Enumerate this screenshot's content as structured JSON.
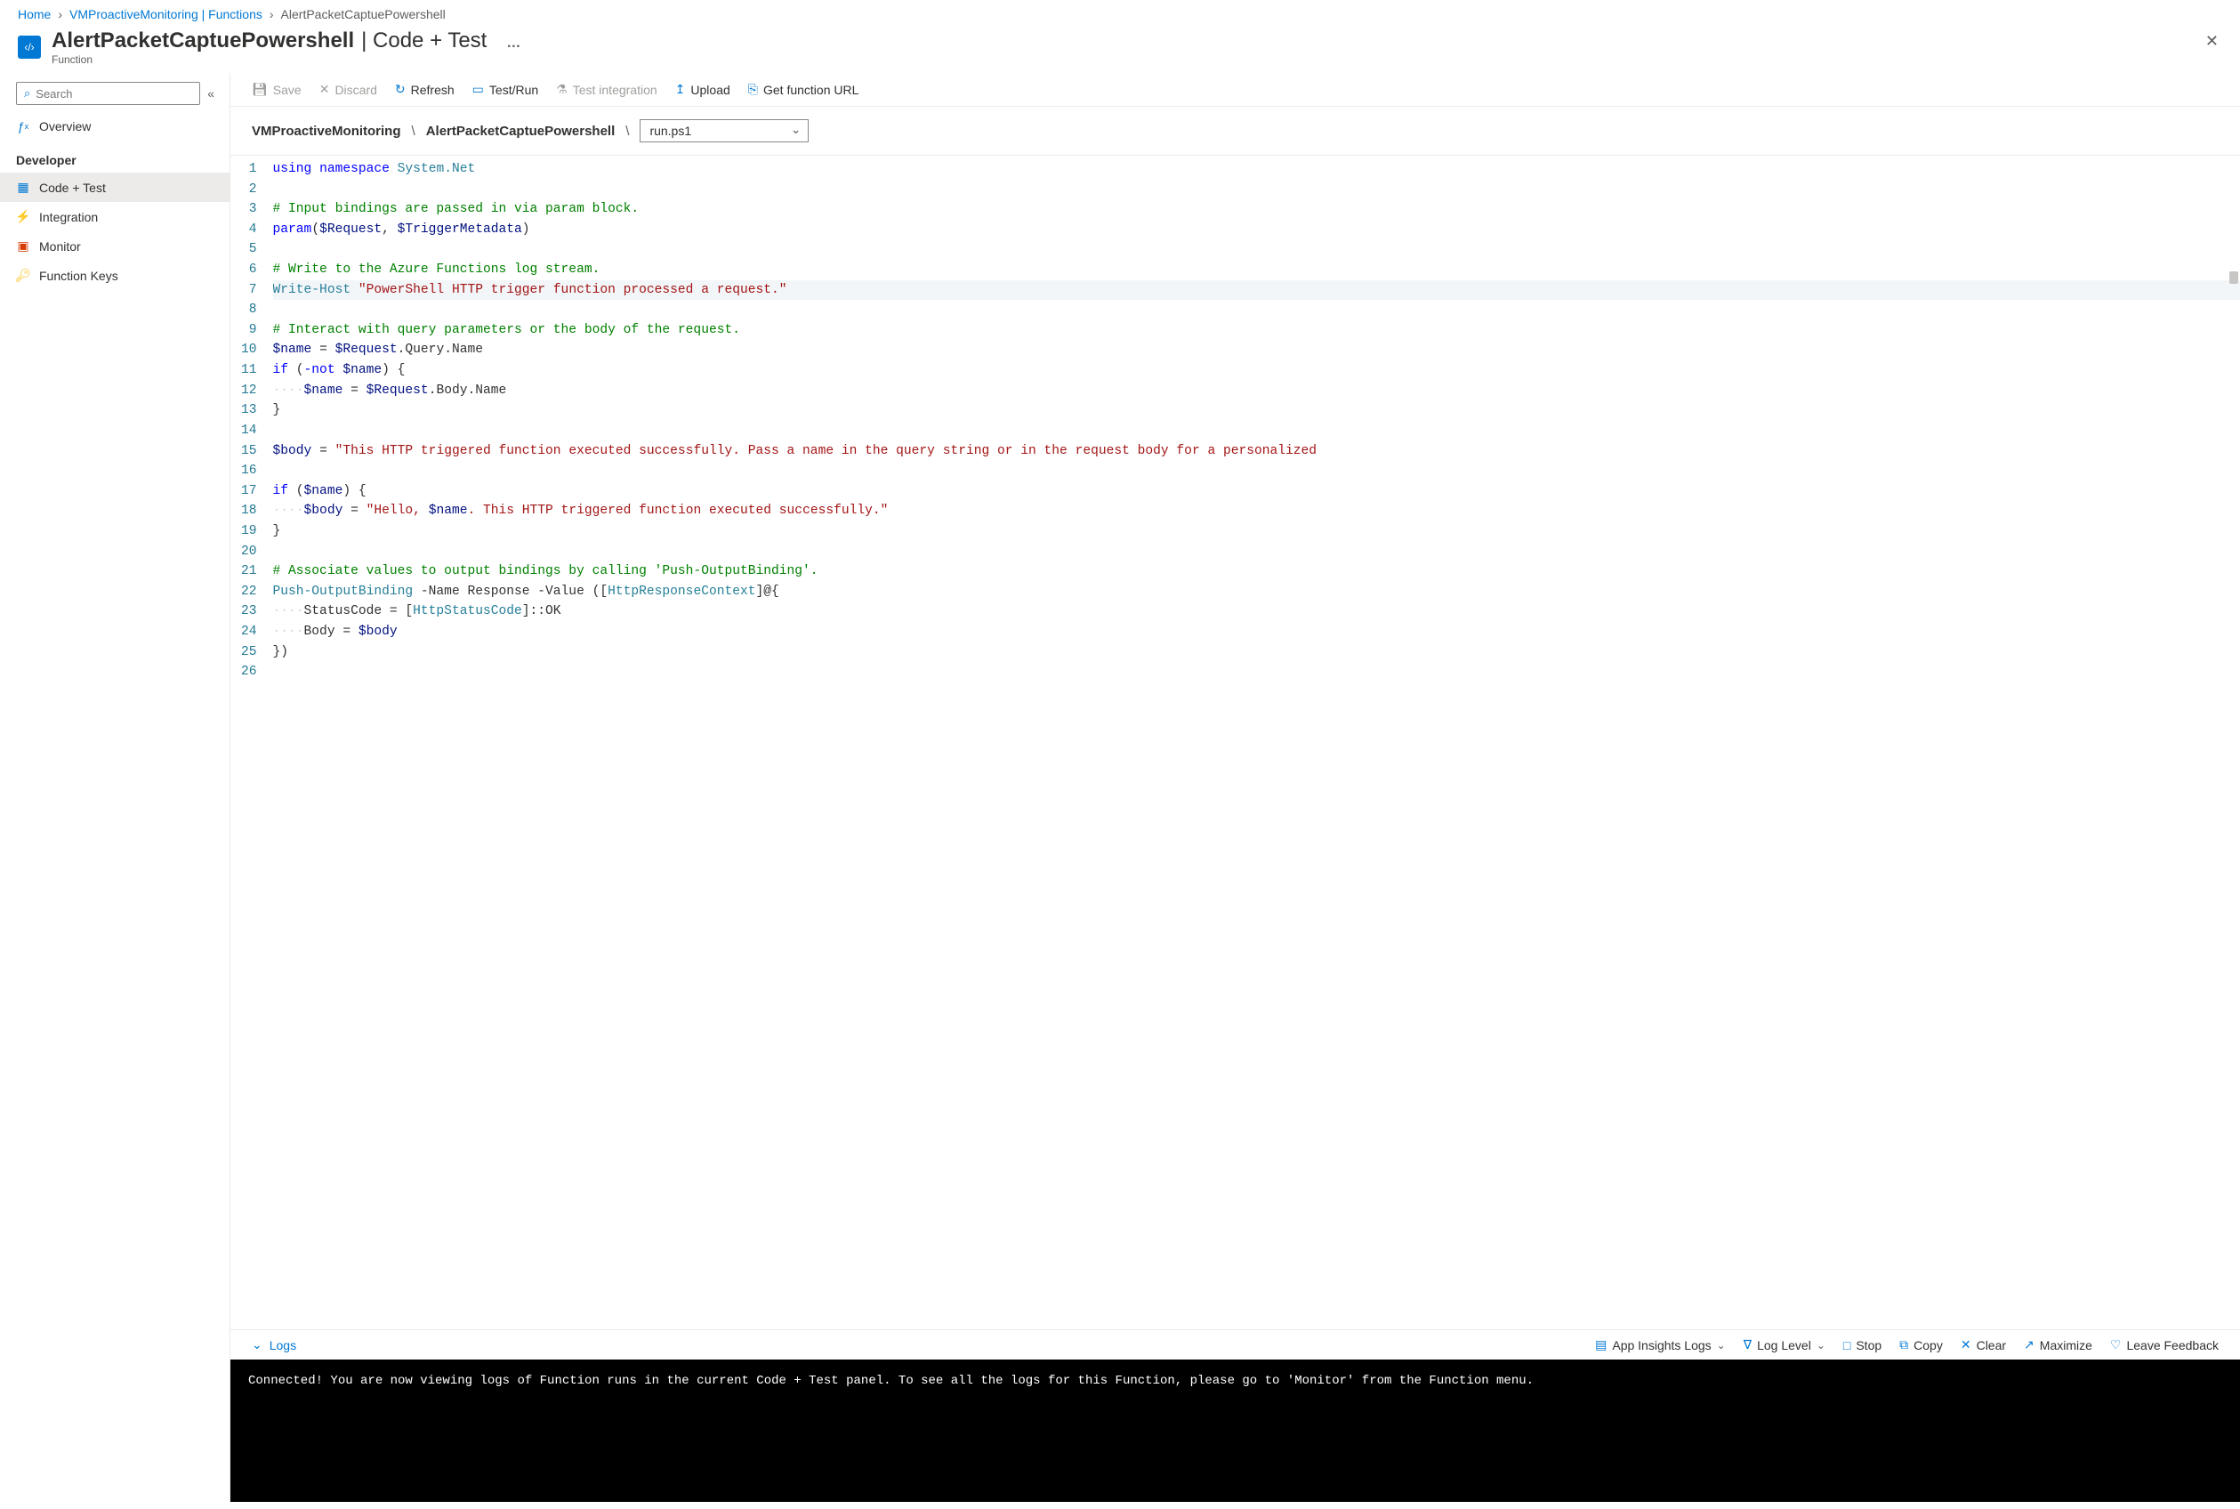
{
  "breadcrumbs": {
    "home": "Home",
    "mid": "VMProactiveMonitoring | Functions",
    "current": "AlertPacketCaptuePowershell"
  },
  "header": {
    "title_main": "AlertPacketCaptuePowershell",
    "title_suffix": "| Code + Test",
    "subtitle": "Function",
    "more": "…"
  },
  "sidebar": {
    "search_placeholder": "Search",
    "overview": "Overview",
    "section_dev": "Developer",
    "items": {
      "code_test": "Code + Test",
      "integration": "Integration",
      "monitor": "Monitor",
      "function_keys": "Function Keys"
    }
  },
  "toolbar": {
    "save": "Save",
    "discard": "Discard",
    "refresh": "Refresh",
    "test_run": "Test/Run",
    "test_integration": "Test integration",
    "upload": "Upload",
    "get_url": "Get function URL"
  },
  "pathbar": {
    "seg1": "VMProactiveMonitoring",
    "seg2": "AlertPacketCaptuePowershell",
    "file": "run.ps1"
  },
  "code": {
    "total_lines": 26,
    "lines": [
      {
        "n": 1,
        "html": "<span class='tk-kw'>using</span> <span class='tk-kw'>namespace</span> <span class='tk-id'>System.Net</span>"
      },
      {
        "n": 2,
        "html": ""
      },
      {
        "n": 3,
        "html": "<span class='tk-cmt'># Input bindings are passed in via param block.</span>"
      },
      {
        "n": 4,
        "html": "<span class='tk-kw'>param</span>(<span class='tk-var'>$Request</span>, <span class='tk-var'>$TriggerMetadata</span>)"
      },
      {
        "n": 5,
        "html": ""
      },
      {
        "n": 6,
        "html": "<span class='tk-cmt'># Write to the Azure Functions log stream.</span>"
      },
      {
        "n": 7,
        "html": "<span class='tk-id'>Write-Host</span> <span class='tk-str'>\"PowerShell HTTP trigger function processed a request.\"</span>",
        "hl": true
      },
      {
        "n": 8,
        "html": ""
      },
      {
        "n": 9,
        "html": "<span class='tk-cmt'># Interact with query parameters or the body of the request.</span>"
      },
      {
        "n": 10,
        "html": "<span class='tk-var'>$name</span> = <span class='tk-var'>$Request</span>.Query.Name"
      },
      {
        "n": 11,
        "html": "<span class='tk-kw'>if</span> (<span class='tk-kw'>-not</span> <span class='tk-var'>$name</span>) {"
      },
      {
        "n": 12,
        "html": "<span class='indent-dots'>····</span><span class='tk-var'>$name</span> = <span class='tk-var'>$Request</span>.Body.Name"
      },
      {
        "n": 13,
        "html": "}"
      },
      {
        "n": 14,
        "html": ""
      },
      {
        "n": 15,
        "html": "<span class='tk-var'>$body</span> = <span class='tk-str'>\"This HTTP triggered function executed successfully. Pass a name in the query string or in the request body for a personalized</span>"
      },
      {
        "n": 16,
        "html": ""
      },
      {
        "n": 17,
        "html": "<span class='tk-kw'>if</span> (<span class='tk-var'>$name</span>) {"
      },
      {
        "n": 18,
        "html": "<span class='indent-dots'>····</span><span class='tk-var'>$body</span> = <span class='tk-str'>\"Hello, <span class='tk-var'>$name</span>. This HTTP triggered function executed successfully.\"</span>"
      },
      {
        "n": 19,
        "html": "}"
      },
      {
        "n": 20,
        "html": ""
      },
      {
        "n": 21,
        "html": "<span class='tk-cmt'># Associate values to output bindings by calling 'Push-OutputBinding'.</span>"
      },
      {
        "n": 22,
        "html": "<span class='tk-id'>Push-OutputBinding</span> -Name Response -Value ([<span class='tk-id'>HttpResponseContext</span>]@{"
      },
      {
        "n": 23,
        "html": "<span class='indent-dots'>····</span>StatusCode = [<span class='tk-id'>HttpStatusCode</span>]::OK"
      },
      {
        "n": 24,
        "html": "<span class='indent-dots'>····</span>Body = <span class='tk-var'>$body</span>"
      },
      {
        "n": 25,
        "html": "})"
      },
      {
        "n": 26,
        "html": ""
      }
    ]
  },
  "logs": {
    "title": "Logs",
    "app_insights": "App Insights Logs",
    "log_level": "Log Level",
    "stop": "Stop",
    "copy": "Copy",
    "clear": "Clear",
    "maximize": "Maximize",
    "feedback": "Leave Feedback",
    "console_text": "Connected! You are now viewing logs of Function runs in the current Code + Test panel. To see all the logs for this Function, please go to 'Monitor' from the Function menu."
  }
}
